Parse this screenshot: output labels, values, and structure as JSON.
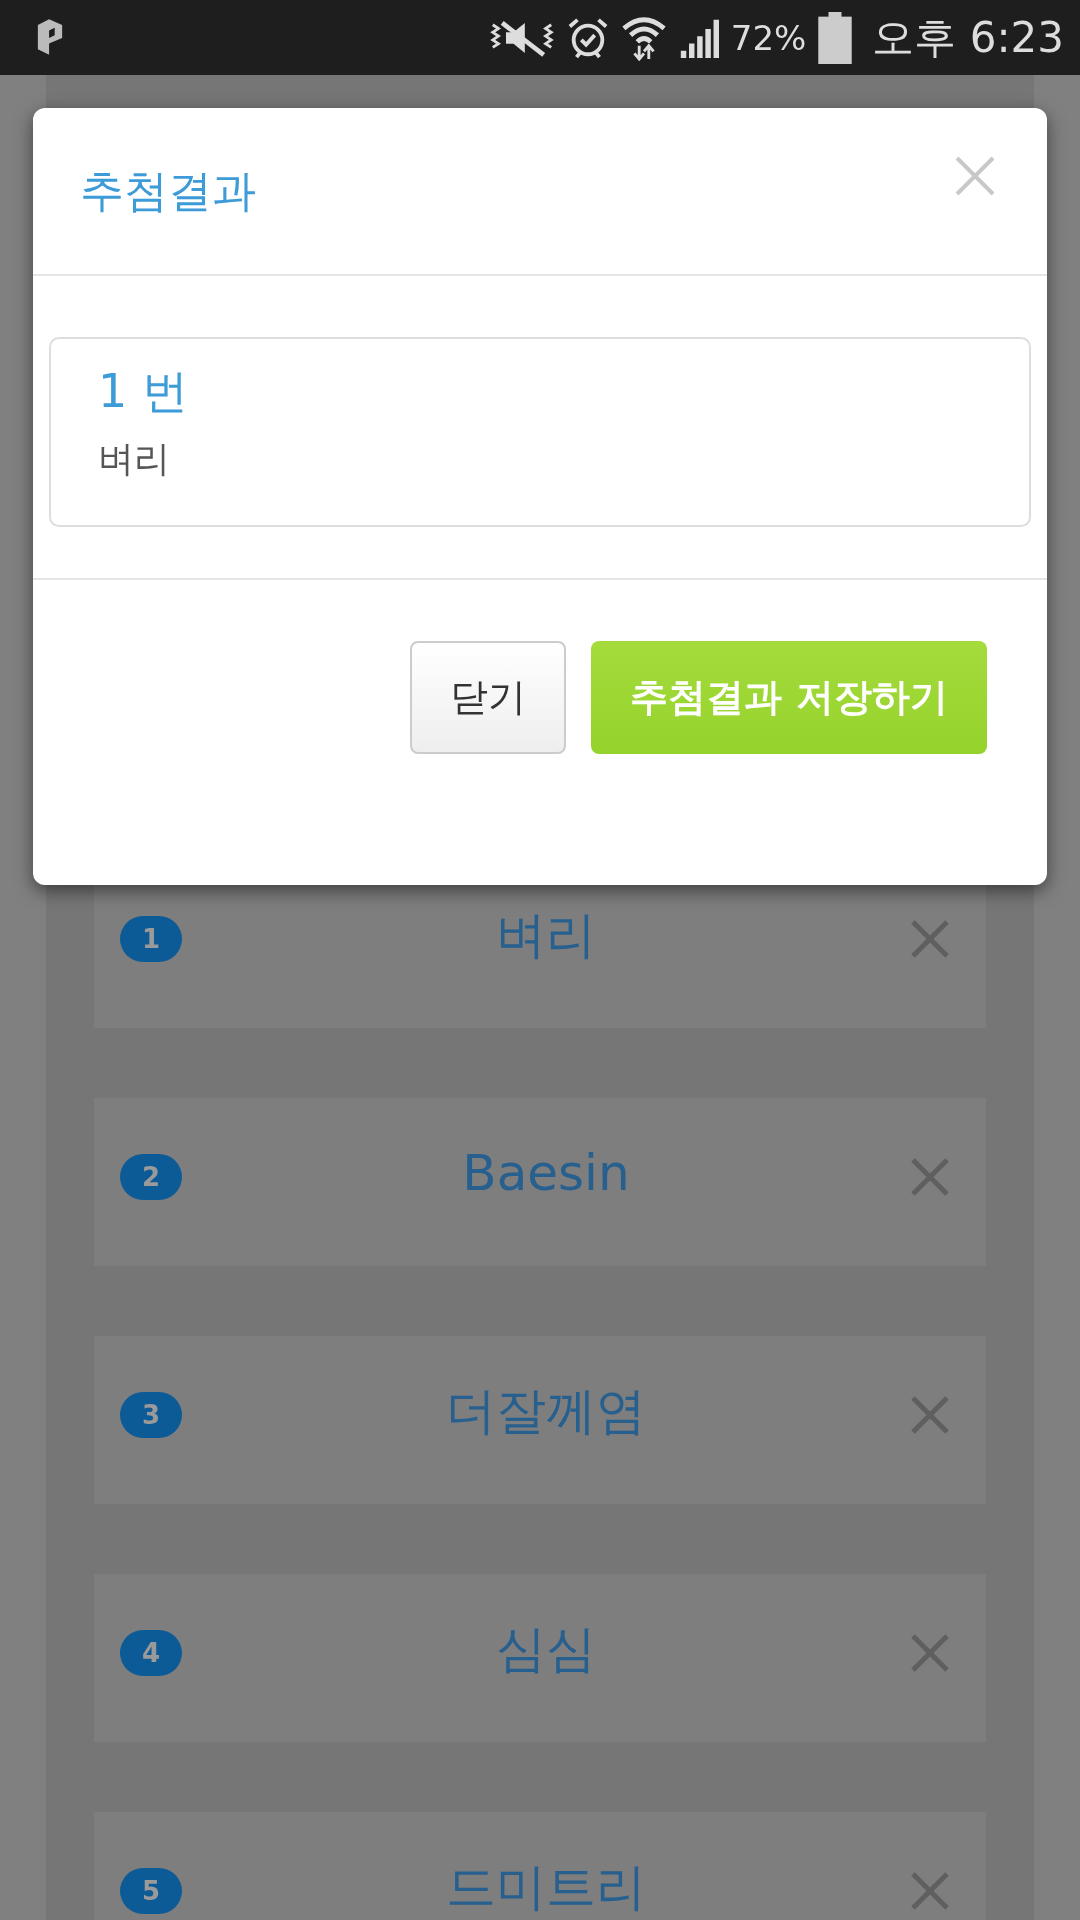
{
  "status_bar": {
    "battery": "72%",
    "time": "오후 6:23"
  },
  "modal": {
    "title": "추첨결과",
    "result": {
      "number": "1 번",
      "name": "벼리"
    },
    "buttons": [
      {
        "label": "닫기",
        "kind": "secondary"
      },
      {
        "label": "추첨결과 저장하기",
        "kind": "primary"
      }
    ]
  },
  "participants": [
    {
      "number": "1",
      "name": "벼리"
    },
    {
      "number": "2",
      "name": "Baesin"
    },
    {
      "number": "3",
      "name": "더잘께염"
    },
    {
      "number": "4",
      "name": "심심"
    },
    {
      "number": "5",
      "name": "드미트리"
    }
  ]
}
